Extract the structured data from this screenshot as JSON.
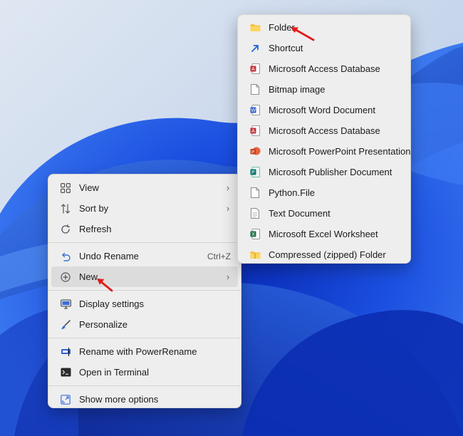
{
  "colors": {
    "menu_bg": "#eeeeee",
    "hover_bg": "#dcdcdc",
    "wallpaper_blue": "#1646d8",
    "annotation_arrow": "#e11b1b"
  },
  "context_menu": {
    "view": {
      "label": "View",
      "icon": "grid-icon"
    },
    "sort_by": {
      "label": "Sort by",
      "icon": "sort-icon"
    },
    "refresh": {
      "label": "Refresh",
      "icon": "refresh-icon"
    },
    "undo_rename": {
      "label": "Undo Rename",
      "shortcut": "Ctrl+Z",
      "icon": "undo-icon"
    },
    "new": {
      "label": "New",
      "icon": "plus-circle-icon"
    },
    "display_settings": {
      "label": "Display settings",
      "icon": "display-icon"
    },
    "personalize": {
      "label": "Personalize",
      "icon": "brush-icon"
    },
    "powerrename": {
      "label": "Rename with PowerRename",
      "icon": "powerrename-icon"
    },
    "terminal": {
      "label": "Open in Terminal",
      "icon": "terminal-icon"
    },
    "show_more": {
      "label": "Show more options",
      "icon": "expand-icon"
    }
  },
  "new_submenu": [
    {
      "label": "Folder",
      "icon": "folder-icon"
    },
    {
      "label": "Shortcut",
      "icon": "shortcut-icon"
    },
    {
      "label": "Microsoft Access Database",
      "icon": "access-icon"
    },
    {
      "label": "Bitmap image",
      "icon": "bitmap-icon"
    },
    {
      "label": "Microsoft Word Document",
      "icon": "word-icon"
    },
    {
      "label": "Microsoft Access Database",
      "icon": "access-icon"
    },
    {
      "label": "Microsoft PowerPoint Presentation",
      "icon": "powerpoint-icon"
    },
    {
      "label": "Microsoft Publisher Document",
      "icon": "publisher-icon"
    },
    {
      "label": "Python.File",
      "icon": "python-file-icon"
    },
    {
      "label": "Text Document",
      "icon": "text-document-icon"
    },
    {
      "label": "Microsoft Excel Worksheet",
      "icon": "excel-icon"
    },
    {
      "label": "Compressed (zipped) Folder",
      "icon": "zip-folder-icon"
    }
  ]
}
